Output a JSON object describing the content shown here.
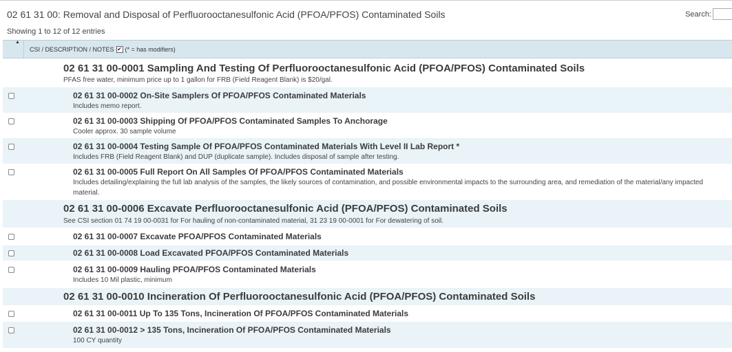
{
  "title": "02 61 31 00: Removal and Disposal of Perfluorooctanesulfonic Acid (PFOA/PFOS) Contaminated Soils",
  "search": {
    "label": "Search:",
    "value": ""
  },
  "showing": "Showing 1 to 12 of 12 entries",
  "table_header": {
    "sort_icon": "sort-up-icon",
    "column_label": "CSI / DESCRIPTION / NOTES",
    "check_mark": "✔",
    "modifiers_note": "(* = has modifiers)"
  },
  "rows": [
    {
      "level": 1,
      "title": "02 61 31 00-0001 Sampling And Testing Of Perfluorooctanesulfonic Acid (PFOA/PFOS) Contaminated Soils",
      "note": "PFAS free water, minimum price up to 1 gallon for FRB (Field Reagent Blank) is $20/gal."
    },
    {
      "level": 2,
      "title": "02 61 31 00-0002 On-Site Samplers Of PFOA/PFOS Contaminated Materials",
      "note": "Includes memo report."
    },
    {
      "level": 2,
      "title": "02 61 31 00-0003 Shipping Of PFOA/PFOS Contaminated Samples To Anchorage",
      "note": "Cooler approx. 30 sample volume"
    },
    {
      "level": 2,
      "title": "02 61 31 00-0004 Testing Sample Of PFOA/PFOS Contaminated Materials With Level II Lab Report *",
      "note": "Includes FRB (Field Reagent Blank) and DUP (duplicate sample). Includes disposal of sample after testing."
    },
    {
      "level": 2,
      "title": "02 61 31 00-0005 Full Report On All Samples Of PFOA/PFOS Contaminated Materials",
      "note": "Includes detailing/explaining the full lab analysis of the samples, the likely sources of contamination, and possible environmental impacts to the surrounding area, and remediation of the material/any impacted material."
    },
    {
      "level": 1,
      "title": "02 61 31 00-0006 Excavate Perfluorooctanesulfonic Acid (PFOA/PFOS) Contaminated Soils",
      "note": "See CSI section 01 74 19 00-0031 for For hauling of non-contaminated material, 31 23 19 00-0001 for For dewatering of soil."
    },
    {
      "level": 2,
      "title": "02 61 31 00-0007 Excavate PFOA/PFOS Contaminated Materials",
      "note": ""
    },
    {
      "level": 2,
      "title": "02 61 31 00-0008 Load Excavated PFOA/PFOS Contaminated Materials",
      "note": ""
    },
    {
      "level": 2,
      "title": "02 61 31 00-0009 Hauling PFOA/PFOS Contaminated Materials",
      "note": "Includes 10 Mil plastic, minimum"
    },
    {
      "level": 1,
      "title": "02 61 31 00-0010 Incineration Of Perfluorooctanesulfonic Acid (PFOA/PFOS) Contaminated Soils",
      "note": ""
    },
    {
      "level": 2,
      "title": "02 61 31 00-0011 Up To 135 Tons, Incineration Of PFOA/PFOS Contaminated Materials",
      "note": ""
    },
    {
      "level": 2,
      "title": "02 61 31 00-0012 > 135 Tons, Incineration Of PFOA/PFOS Contaminated Materials",
      "note": "100 CY quantity"
    }
  ]
}
